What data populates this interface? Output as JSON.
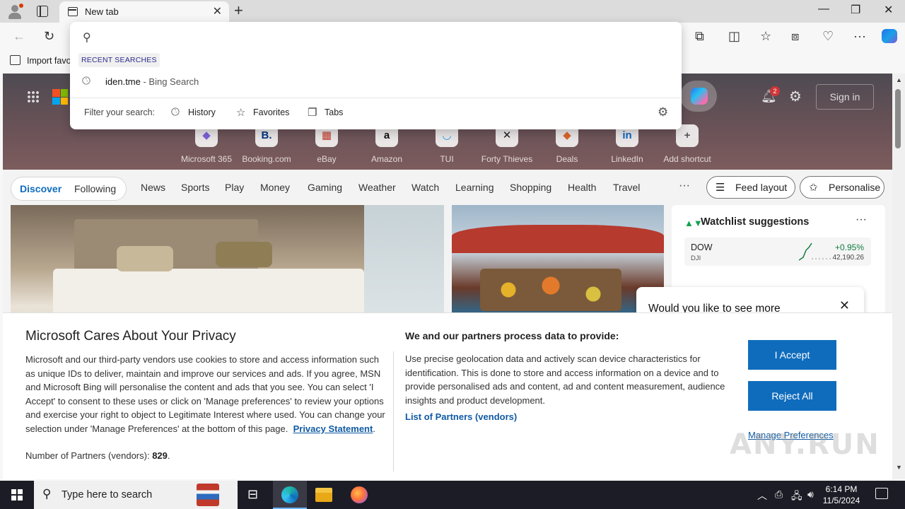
{
  "browser": {
    "tab_title": "New tab",
    "new_tab_symbol": "+",
    "window_controls": {
      "minimize": "—",
      "maximize": "❐",
      "close": "✕"
    },
    "favorites_bar": {
      "import_label": "Import favo"
    },
    "toolbar_icons": [
      "back-icon",
      "refresh-icon",
      "extensions-icon",
      "split-screen-icon",
      "favorites-icon",
      "collections-icon",
      "performance-icon",
      "more-icon",
      "copilot-icon"
    ]
  },
  "address_dropdown": {
    "input_value": "",
    "recent_label": "RECENT SEARCHES",
    "recent": [
      {
        "query": "iden.tme",
        "source": " - Bing Search"
      }
    ],
    "filter_label": "Filter your search:",
    "filters": [
      {
        "label": "History",
        "icon": "history-icon"
      },
      {
        "label": "Favorites",
        "icon": "star-icon"
      },
      {
        "label": "Tabs",
        "icon": "tabs-icon"
      }
    ]
  },
  "hero": {
    "notification_count": "2",
    "sign_in": "Sign in",
    "shortcuts": [
      {
        "label": "Microsoft 365",
        "glyph": "◆",
        "color": "#7b5fd6"
      },
      {
        "label": "Booking.com",
        "glyph": "B.",
        "color": "#003580"
      },
      {
        "label": "eBay",
        "glyph": "▦",
        "color": "#c0392b"
      },
      {
        "label": "Amazon",
        "glyph": "a",
        "color": "#111111"
      },
      {
        "label": "TUI",
        "glyph": "◡",
        "color": "#1ba0e2"
      },
      {
        "label": "Forty Thieves",
        "glyph": "✕",
        "color": "#222222"
      },
      {
        "label": "Deals",
        "glyph": "◆",
        "color": "#d9652b"
      },
      {
        "label": "LinkedIn",
        "glyph": "in",
        "color": "#0a66c2"
      },
      {
        "label": "Add shortcut",
        "glyph": "+",
        "color": "#555555"
      }
    ]
  },
  "feed_nav": {
    "discover": "Discover",
    "following": "Following",
    "items": [
      "News",
      "Sports",
      "Play",
      "Money",
      "Gaming",
      "Weather",
      "Watch",
      "Learning",
      "Shopping",
      "Health",
      "Travel"
    ],
    "more": "···",
    "feed_layout": "Feed layout",
    "personalise": "Personalise"
  },
  "watchlist": {
    "title": "Watchlist suggestions",
    "more": "···",
    "rows": [
      {
        "symbol": "DOW",
        "sub": "DJI",
        "change": "+0.95%",
        "price": "42,190.26"
      }
    ]
  },
  "popup": {
    "text": "Would you like to see more",
    "close": "✕"
  },
  "privacy": {
    "title": "Microsoft Cares About Your Privacy",
    "body": "Microsoft and our third-party vendors use cookies to store and access information such as unique IDs to deliver, maintain and improve our services and ads. If you agree, MSN and Microsoft Bing will personalise the content and ads that you see. You can select 'I Accept' to consent to these uses or click on 'Manage preferences' to review your options and exercise your right to object to Legitimate Interest where used.  You can change your selection under 'Manage Preferences' at the bottom of this page.",
    "privacy_link": "Privacy Statement",
    "count_label": "Number of Partners (vendors):",
    "count_value": "829",
    "right_title": "We and our partners process data to provide:",
    "right_body": "Use precise geolocation data and actively scan device characteristics for identification. This is done to store and access information on a device and to provide personalised ads and content, ad and content measurement, audience insights and product development.",
    "partners_link": "List of Partners (vendors)",
    "accept": "I Accept",
    "reject": "Reject All",
    "manage": "Manage Preferences"
  },
  "watermark": "ANY.RUN",
  "taskbar": {
    "search_placeholder": "Type here to search",
    "time": "6:14 PM",
    "date": "11/5/2024",
    "apps": [
      "task-view-icon",
      "edge-icon",
      "file-explorer-icon",
      "firefox-icon"
    ]
  }
}
